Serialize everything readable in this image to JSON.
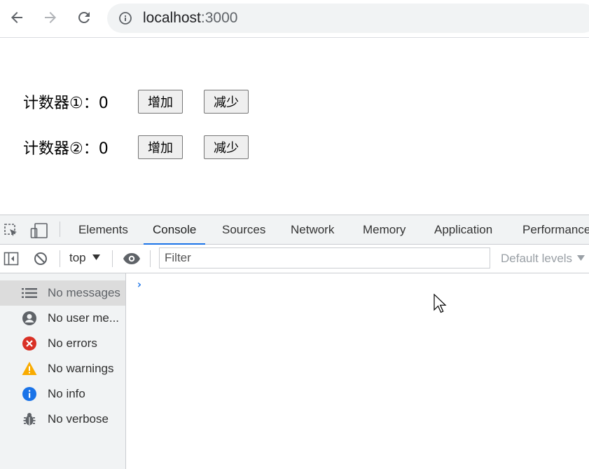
{
  "browser": {
    "url_host": "localhost",
    "url_port": ":3000"
  },
  "page": {
    "counters": [
      {
        "label": "计数器①：",
        "value": "0",
        "inc_label": "增加",
        "dec_label": "减少"
      },
      {
        "label": "计数器②：",
        "value": "0",
        "inc_label": "增加",
        "dec_label": "减少"
      }
    ]
  },
  "devtools": {
    "tabs": [
      "Elements",
      "Console",
      "Sources",
      "Network",
      "Memory",
      "Application",
      "Performance"
    ],
    "active_tab": "Console",
    "toolbar": {
      "context": "top",
      "filter_placeholder": "Filter",
      "levels": "Default levels"
    },
    "sidebar": [
      {
        "label": "No messages",
        "icon": "list-icon"
      },
      {
        "label": "No user me...",
        "icon": "user-icon"
      },
      {
        "label": "No errors",
        "icon": "error-icon",
        "color": "#d93025"
      },
      {
        "label": "No warnings",
        "icon": "warning-icon",
        "color": "#f9ab00"
      },
      {
        "label": "No info",
        "icon": "info-icon",
        "color": "#1a73e8"
      },
      {
        "label": "No verbose",
        "icon": "bug-icon"
      }
    ],
    "prompt": "›"
  }
}
